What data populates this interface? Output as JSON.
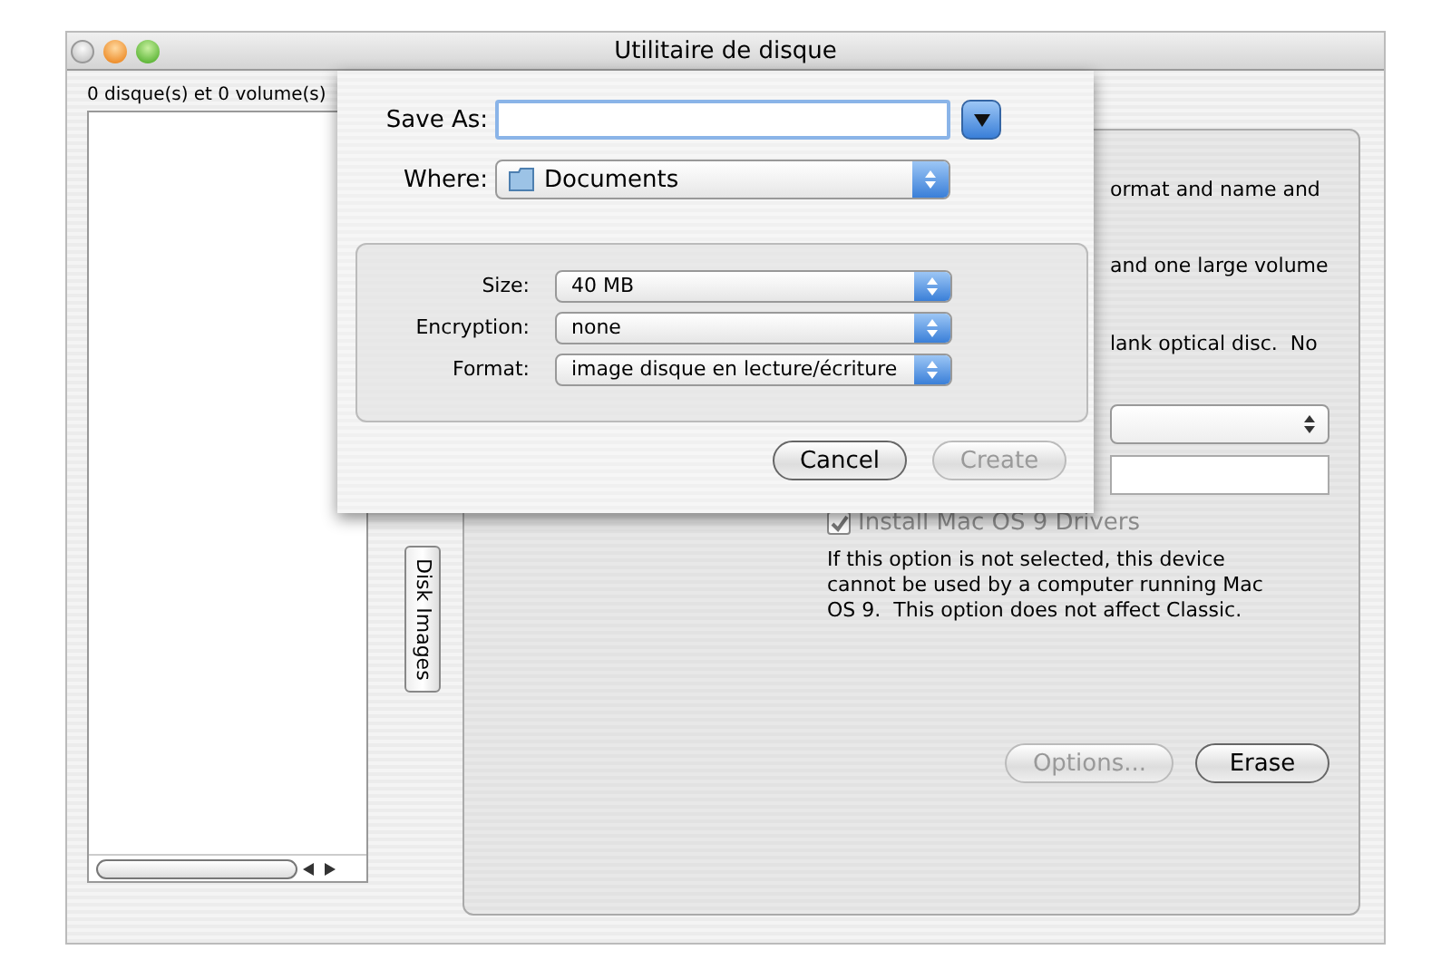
{
  "window": {
    "title": "Utilitaire de disque"
  },
  "sidebar": {
    "summary": "0 disque(s) et 0 volume(s)"
  },
  "tabs": [
    {
      "label": "Disk Images",
      "selected": false
    }
  ],
  "erase_panel": {
    "text_fragments": [
      "ormat and name and",
      "and one large volume",
      "lank optical disc.  No"
    ],
    "checkbox": {
      "label": "Install Mac OS 9 Drivers",
      "checked": true,
      "disabled": true
    },
    "help_text": "If this option is not selected, this device cannot be used by a computer running Mac OS 9.  This option does not affect Classic.",
    "buttons": [
      {
        "label": "Options...",
        "disabled": true
      },
      {
        "label": "Erase",
        "disabled": false
      }
    ]
  },
  "sheet": {
    "save_as": {
      "label": "Save As:"
    },
    "where": {
      "label": "Where:",
      "value": "Documents"
    },
    "options": [
      {
        "label": "Size:",
        "value": "40 MB"
      },
      {
        "label": "Encryption:",
        "value": "none"
      },
      {
        "label": "Format:",
        "value": "image disque en lecture/écriture"
      }
    ],
    "buttons": [
      {
        "label": "Cancel",
        "disabled": false
      },
      {
        "label": "Create",
        "disabled": true
      }
    ]
  }
}
